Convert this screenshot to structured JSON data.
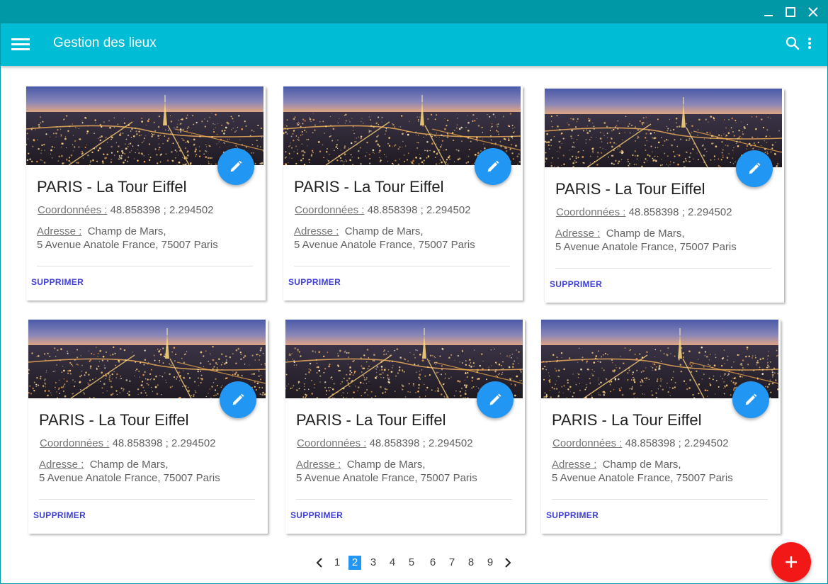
{
  "app": {
    "title": "Gestion des lieux"
  },
  "icons": {
    "menu": "menu-icon",
    "search": "search-icon",
    "more": "more-vertical-icon",
    "edit": "pencil-icon",
    "add": "plus-icon",
    "minimize": "minimize-icon",
    "maximize": "maximize-icon",
    "close": "close-icon"
  },
  "colors": {
    "titlebar": "#0097a7",
    "appbar": "#00bcd4",
    "edit_fab": "#2196f3",
    "add_fab": "#f21818",
    "action_text": "#3f3fd8"
  },
  "cards": [
    {
      "title": "PARIS - La Tour Eiffel",
      "coords_label": "Coordonnées :",
      "coords_value": "48.858398 ; 2.294502",
      "address_label": "Adresse :",
      "address_line1": "Champ de Mars,",
      "address_line2": "5 Avenue Anatole France, 75007 Paris",
      "delete_label": "SUPPRIMER"
    },
    {
      "title": "PARIS - La Tour Eiffel",
      "coords_label": "Coordonnées :",
      "coords_value": "48.858398 ; 2.294502",
      "address_label": "Adresse :",
      "address_line1": "Champ de Mars,",
      "address_line2": "5 Avenue Anatole France, 75007 Paris",
      "delete_label": "SUPPRIMER"
    },
    {
      "title": "PARIS - La Tour Eiffel",
      "coords_label": "Coordonnées :",
      "coords_value": "48.858398 ; 2.294502",
      "address_label": "Adresse :",
      "address_line1": "Champ de Mars,",
      "address_line2": "5 Avenue Anatole France, 75007 Paris",
      "delete_label": "SUPPRIMER"
    },
    {
      "title": "PARIS - La Tour Eiffel",
      "coords_label": "Coordonnées :",
      "coords_value": "48.858398 ; 2.294502",
      "address_label": "Adresse :",
      "address_line1": "Champ de Mars,",
      "address_line2": "5 Avenue Anatole France, 75007 Paris",
      "delete_label": "SUPPRIMER"
    },
    {
      "title": "PARIS - La Tour Eiffel",
      "coords_label": "Coordonnées :",
      "coords_value": "48.858398 ; 2.294502",
      "address_label": "Adresse :",
      "address_line1": "Champ de Mars,",
      "address_line2": "5 Avenue Anatole France, 75007 Paris",
      "delete_label": "SUPPRIMER"
    },
    {
      "title": "PARIS - La Tour Eiffel",
      "coords_label": "Coordonnées :",
      "coords_value": "48.858398 ; 2.294502",
      "address_label": "Adresse :",
      "address_line1": "Champ de Mars,",
      "address_line2": "5 Avenue Anatole France, 75007 Paris",
      "delete_label": "SUPPRIMER"
    }
  ],
  "pagination": {
    "pages": [
      "1",
      "2",
      "3",
      "4",
      "5",
      "6",
      "7",
      "8",
      "9"
    ],
    "current": "2"
  }
}
